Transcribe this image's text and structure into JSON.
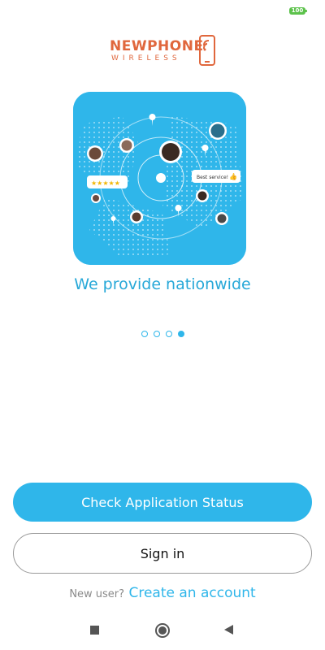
{
  "status_bar": {
    "battery": "100"
  },
  "logo": {
    "line1": "NEWPHONE",
    "line2": "WIRELESS"
  },
  "hero": {
    "chat_bubble": "Best service!"
  },
  "headline": "We provide nationwide",
  "pager": {
    "count": 4,
    "active_index": 3
  },
  "buttons": {
    "check_status": "Check Application Status",
    "sign_in": "Sign in"
  },
  "signup": {
    "prefix": "New user?",
    "link": "Create an account"
  },
  "colors": {
    "accent": "#2fb6ea",
    "brand": "#e0673d",
    "battery": "#5cc24b"
  },
  "nav_bar": {
    "icons": [
      "recents-square-icon",
      "home-circle-icon",
      "back-triangle-icon"
    ]
  }
}
